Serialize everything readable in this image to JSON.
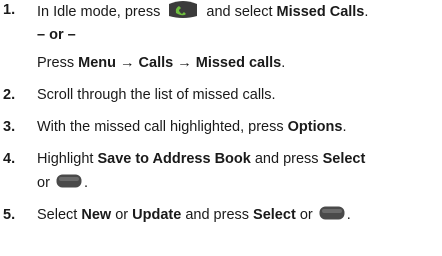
{
  "steps": [
    {
      "num": "1.",
      "pre": "In Idle mode, press",
      "icon": "call-key-icon",
      "mid": "and select",
      "bold": "Missed Calls",
      "end": "."
    },
    {
      "or": "– or –"
    },
    {
      "pre": "Press",
      "path": [
        "Menu",
        "Calls",
        "Missed calls"
      ],
      "arrow": "→",
      "end": "."
    },
    {
      "num": "2.",
      "text": "Scroll through the list of missed calls."
    },
    {
      "num": "3.",
      "pre": "With the missed call highlighted, press",
      "bold": "Options",
      "end": "."
    },
    {
      "num": "4.",
      "pre": "Highlight",
      "bold1": "Save to Address Book",
      "mid": "and press",
      "bold2": "Select",
      "line2_pre": "or",
      "icon": "select-key-icon",
      "end": "."
    },
    {
      "num": "5.",
      "pre": "Select",
      "bold1": "New",
      "mid1": "or",
      "bold2": "Update",
      "mid2": "and press",
      "bold3": "Select",
      "mid3": "or",
      "icon": "select-key-icon",
      "end": "."
    }
  ]
}
